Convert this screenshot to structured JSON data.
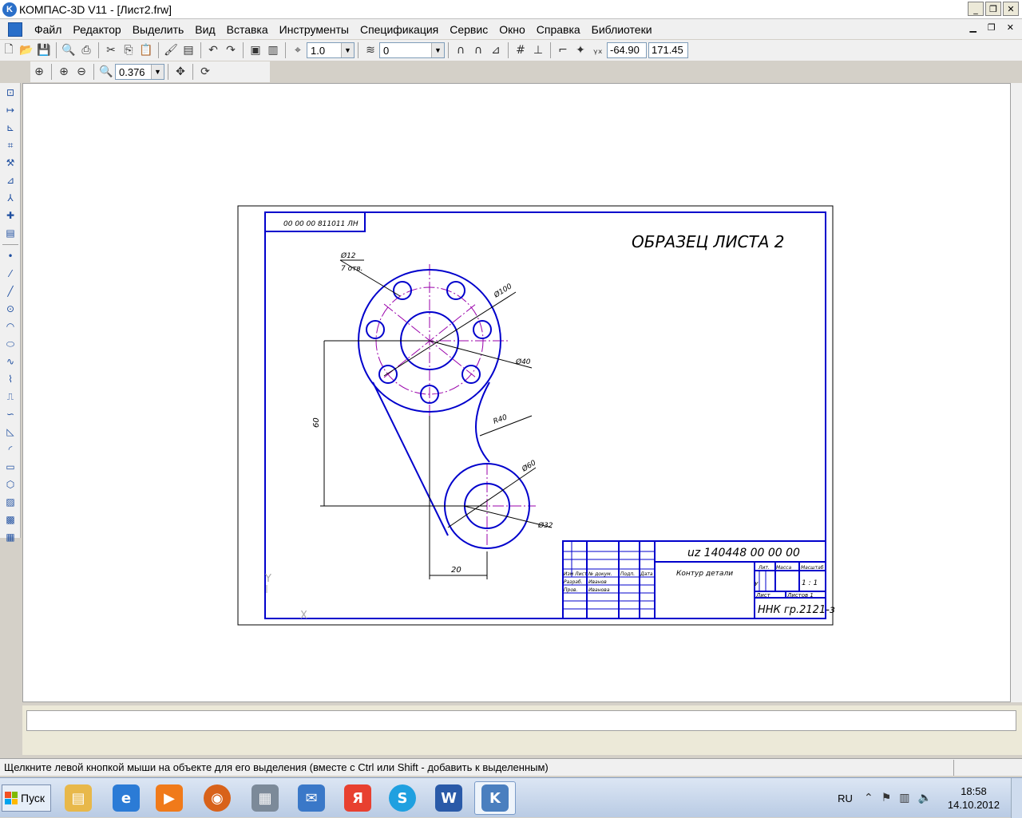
{
  "window": {
    "title": "КОМПАС-3D V11 - [Лист2.frw]",
    "btn_minimize": "_",
    "btn_restore": "❐",
    "btn_close": "✕"
  },
  "menu": [
    "Файл",
    "Редактор",
    "Выделить",
    "Вид",
    "Вставка",
    "Инструменты",
    "Спецификация",
    "Сервис",
    "Окно",
    "Справка",
    "Библиотеки"
  ],
  "toolbar": {
    "step_value": "1.0",
    "layer_value": "0",
    "coord_x": "-64.90",
    "coord_y": "171.45",
    "zoom_value": "0.376"
  },
  "drawing": {
    "doc_code_top": "00 00 00 811011 ЛН",
    "sheet_title": "ОБРАЗЕЦ ЛИСТА 2",
    "hole_dim": "Ø12",
    "hole_count": "7 отв.",
    "dim_d100": "Ø100",
    "dim_d40": "Ø40",
    "dim_r40": "R40",
    "dim_d60": "Ø60",
    "dim_d32": "Ø32",
    "dim_60": "60",
    "dim_20": "20",
    "stamp_code": "uz 140448 00 00 00",
    "part_name": "Контур детали",
    "org": "ННК гр.2121-з",
    "col_lit": "Лит.",
    "col_mass": "Масса",
    "col_scale": "Масштаб",
    "scale_value": "1 : 1",
    "sheet_label": "Лист",
    "sheets_label": "Листов 1",
    "stamp_row1": "Изм Лист",
    "stamp_row1b": "№ докум.",
    "stamp_row1c": "Подп.",
    "stamp_row1d": "Дата",
    "stamp_razrab": "Разраб.",
    "stamp_razrab_name": "Иванов",
    "stamp_prov": "Пров.",
    "stamp_prov_name": "Иванова",
    "stamp_u": "У",
    "axis_y": "Y",
    "axis_x": "X"
  },
  "status": {
    "hint": "Щелкните левой кнопкой мыши на объекте для его выделения (вместе с Ctrl или Shift - добавить к выделенным)"
  },
  "taskbar": {
    "start": "Пуск",
    "lang": "RU",
    "time": "18:58",
    "date": "14.10.2012"
  },
  "colors": {
    "drawing_blue": "#0000cc",
    "axis_magenta": "#9900aa",
    "ui_bg": "#f0f0f0"
  }
}
